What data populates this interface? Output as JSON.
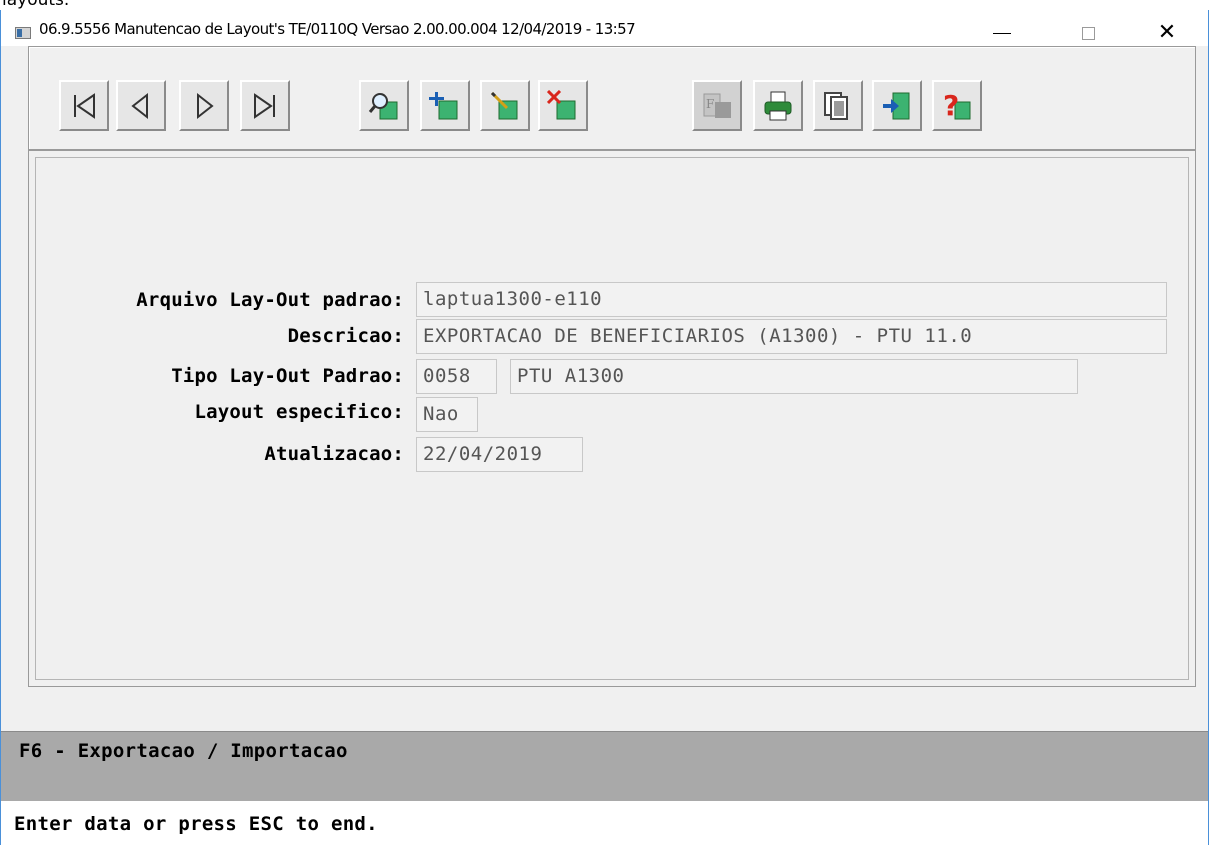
{
  "top_fragment": "layouts.",
  "window": {
    "title": "06.9.5556 Manutencao  de Layout's TE/0110Q Versao 2.00.00.004 12/04/2019 - 13:57",
    "minimize_glyph": "",
    "close_glyph": "✕"
  },
  "toolbar": {
    "buttons": [
      {
        "name": "first-record-button",
        "icon": "first-record-icon"
      },
      {
        "name": "previous-record-button",
        "icon": "previous-record-icon"
      },
      {
        "name": "next-record-button",
        "icon": "next-record-icon"
      },
      {
        "name": "last-record-button",
        "icon": "last-record-icon"
      },
      {
        "name": "search-button",
        "icon": "magnifier-icon"
      },
      {
        "name": "add-button",
        "icon": "add-record-icon"
      },
      {
        "name": "edit-button",
        "icon": "edit-record-icon"
      },
      {
        "name": "delete-button",
        "icon": "delete-record-icon"
      },
      {
        "name": "filter-button",
        "icon": "filter-icon",
        "disabled": true
      },
      {
        "name": "print-button",
        "icon": "printer-icon"
      },
      {
        "name": "copy-button",
        "icon": "copy-icon"
      },
      {
        "name": "exit-button",
        "icon": "exit-door-icon"
      },
      {
        "name": "help-button",
        "icon": "help-icon"
      }
    ]
  },
  "form": {
    "arquivo_label": "Arquivo Lay-Out padrao:",
    "arquivo_value": "laptua1300-e110",
    "descricao_label": "Descricao:",
    "descricao_value": "EXPORTACAO DE BENEFICIARIOS (A1300) - PTU 11.0",
    "tipo_label": "Tipo Lay-Out Padrao:",
    "tipo_code": "0058",
    "tipo_desc": "PTU A1300",
    "especifico_label": "Layout especifico:",
    "especifico_value": "Nao",
    "atualizacao_label": "Atualizacao:",
    "atualizacao_value": "22/04/2019"
  },
  "hint": "F6 - Exportacao / Importacao",
  "status_message": "Enter data or press ESC to end.",
  "colors": {
    "window_bg": "#f0f0f0",
    "hint_bar": "#a9a9a9",
    "icon_green": "#2e8b3a",
    "icon_teal": "#3cb371",
    "icon_red": "#d9261c",
    "window_border": "#4a90d9"
  }
}
